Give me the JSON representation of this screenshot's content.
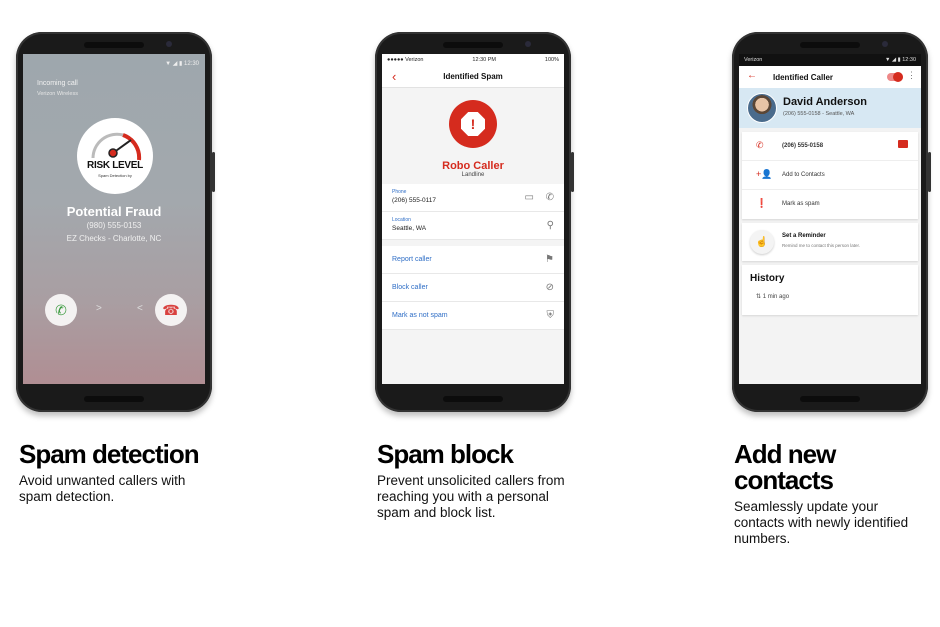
{
  "features": [
    {
      "title": "Spam detection",
      "description": "Avoid unwanted callers with spam detection.",
      "screen": {
        "status_time": "12:30",
        "incoming_label": "Incoming call",
        "carrier": "Verizon Wireless",
        "risk_label": "RISK LEVEL",
        "risk_sub": "Spam Detection by",
        "caller_status": "Potential Fraud",
        "phone": "(980) 555-0153",
        "caller_info": "EZ Checks - Charlotte, NC",
        "chev_right": ">",
        "chev_left": "<"
      }
    },
    {
      "title": "Spam block",
      "description": "Prevent unsolicited callers from reaching you with a personal spam and block list.",
      "screen": {
        "status_carrier": "●●●●● Verizon",
        "status_time": "12:30 PM",
        "status_battery": "100%",
        "nav_title": "Identified Spam",
        "caller_type": "Robo Caller",
        "line_type": "Landline",
        "phone_label": "Phone",
        "phone_value": "(206) 555-0117",
        "location_label": "Location",
        "location_value": "Seattle, WA",
        "actions": [
          "Report caller",
          "Block caller",
          "Mark as not spam"
        ]
      }
    },
    {
      "title": "Add new contacts",
      "description": "Seamlessly update your contacts with newly identified numbers.",
      "screen": {
        "status_carrier": "Verizon",
        "status_time": "12:30",
        "nav_title": "Identified Caller",
        "name": "David Anderson",
        "subtitle": "(206) 555-0158 - Seattle, WA",
        "phone": "(206) 555-0158",
        "add_contacts": "Add to Contacts",
        "mark_spam": "Mark as spam",
        "reminder_title": "Set a Reminder",
        "reminder_sub": "Remind me to contact this person later.",
        "history_title": "History",
        "history_item": "1 min ago"
      }
    }
  ],
  "colors": {
    "brand_red": "#d52b1e",
    "link_blue": "#2f6ec6",
    "accept_green": "#3a9a3e"
  }
}
